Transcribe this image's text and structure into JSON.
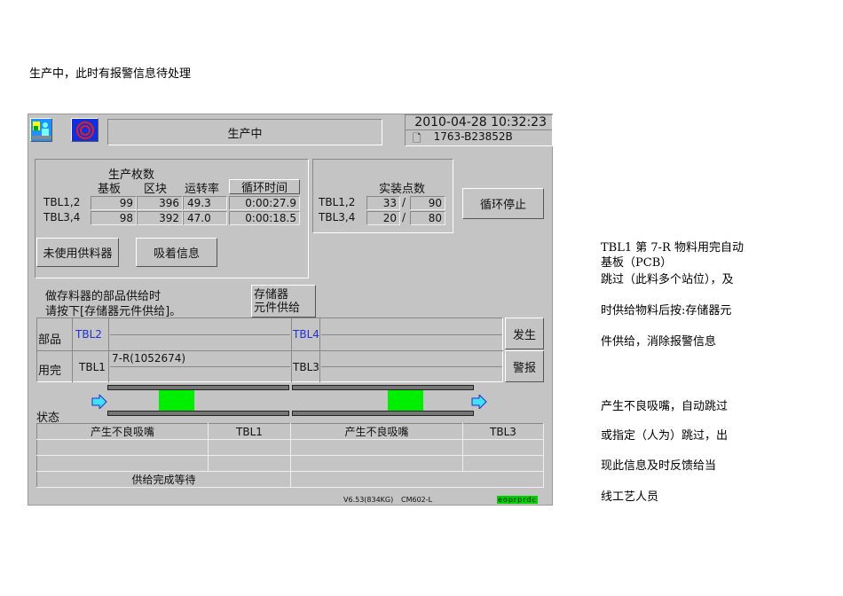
{
  "caption": "生产中，此时有报警信息待处理",
  "screen": {
    "status_title": "生产中",
    "datetime": "2010-04-28  10:32:23",
    "program": "1763-B23852B",
    "production": {
      "title": "生产枚数",
      "headers": [
        "基板",
        "区块",
        "运转率",
        "循环时间"
      ],
      "rows": [
        {
          "label": "TBL1,2",
          "board": "99",
          "block": "396",
          "rate": "49.3",
          "cycle": "0:00:27.9"
        },
        {
          "label": "TBL3,4",
          "board": "98",
          "block": "392",
          "rate": "47.0",
          "cycle": "0:00:18.5"
        }
      ]
    },
    "placement": {
      "title": "实装点数",
      "rows": [
        {
          "label": "TBL1,2",
          "done": "33",
          "total": "90"
        },
        {
          "label": "TBL3,4",
          "done": "20",
          "total": "80"
        }
      ]
    },
    "buttons": {
      "cycle_stop": "循环停止",
      "unused_feeder": "未使用供料器",
      "pickup_info": "吸着信息",
      "storage_supply_1": "存储器",
      "storage_supply_2": "元件供给",
      "occur": "发生",
      "alarm": "警报"
    },
    "hint": [
      "做存料器的部品供给时",
      "请按下[存储器元件供给]。"
    ],
    "parts": {
      "label1": "部品",
      "label2": "用完",
      "tbl2": "TBL2",
      "tbl4": "TBL4",
      "tbl1": "TBL1",
      "tbl3": "TBL3",
      "tbl1_value": "7-R(1052674)"
    },
    "status": {
      "label": "状态",
      "col1": "产生不良吸嘴",
      "col2": "TBL1",
      "col3": "产生不良吸嘴",
      "col4": "TBL3",
      "footer_left": "供给完成等待"
    },
    "footer": {
      "version": "V6.53(834KG)",
      "model": "CM602-L",
      "indicator": "eoprprdc"
    }
  },
  "notes": [
    "TBL1 第 7-R 物料用完自动",
    "基板（PCB）",
    "跳过（此料多个站位），及",
    "时供给物料后按:存储器元",
    "件供给，消除报警信息",
    "产生不良吸嘴，自动跳过",
    "或指定（人为）跳过，出",
    "现此信息及时反馈给当",
    "线工艺人员"
  ]
}
